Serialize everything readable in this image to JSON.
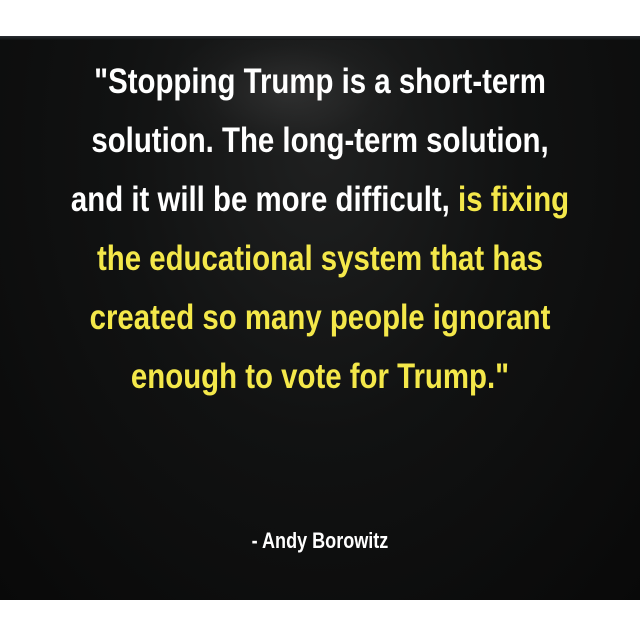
{
  "quote": {
    "line1": "\"Stopping Trump is a short-term",
    "line2": "solution. The long-term solution,",
    "line3_white": "and it will be more difficult, ",
    "line3_yellow": "is fixing",
    "line4": "the educational system that has",
    "line5": "created so many people ignorant",
    "line6": "enough to vote for Trump.\""
  },
  "attribution": "- Andy Borowitz",
  "colors": {
    "background": "#0d0e0e",
    "text_white": "#ffffff",
    "text_yellow": "#f4e84a"
  }
}
